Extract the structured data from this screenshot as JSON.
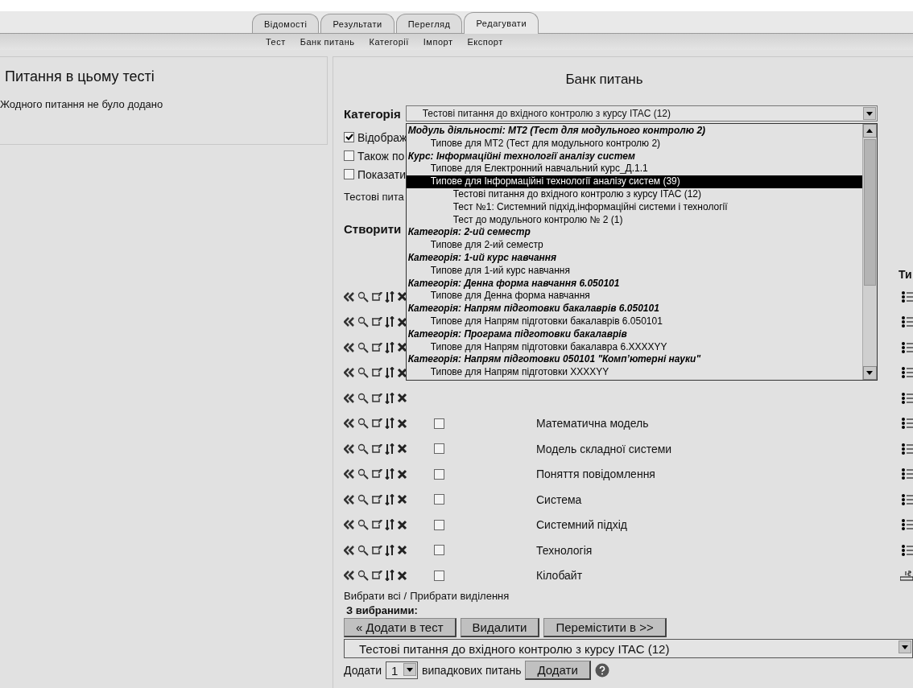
{
  "tabs": [
    {
      "label": "Відомості",
      "selected": false
    },
    {
      "label": "Результати",
      "selected": false
    },
    {
      "label": "Перегляд",
      "selected": false
    },
    {
      "label": "Редагувати",
      "selected": true
    }
  ],
  "subnav": [
    "Тест",
    "Банк питань",
    "Категорії",
    "Імпорт",
    "Експорт"
  ],
  "left_panel": {
    "title": "Питання в цьому тесті",
    "message": "Жодного питання не було додано"
  },
  "bank": {
    "title": "Банк питань",
    "category_label": "Категорія",
    "category_value": "Тестові питання до вхідного контролю з курсу ITAC (12)",
    "category_list": [
      {
        "kind": "group",
        "label": "Модуль діяльності: МТ2 (Тест для модульного контролю 2)",
        "children": [
          {
            "kind": "option",
            "label": "Типове для МТ2 (Тест для модульного контролю 2)",
            "selected": false
          }
        ]
      },
      {
        "kind": "group",
        "label": "Курс: Інформаційні технології аналізу систем",
        "children": [
          {
            "kind": "option",
            "label": "Типове для Електронний навчальний курс_Д.1.1",
            "selected": false
          },
          {
            "kind": "option",
            "label": "Типове для Інформаційні технології аналізу систем (39)",
            "selected": true,
            "children": [
              {
                "kind": "option",
                "label": "Тестові питання до вхідного контролю з курсу ITAC (12)",
                "selected": false
              },
              {
                "kind": "option",
                "label": "Тест №1: Системний підхід,інформаційні системи і технології",
                "selected": false
              },
              {
                "kind": "option",
                "label": "Тест до модульного контролю № 2 (1)",
                "selected": false
              }
            ]
          }
        ]
      },
      {
        "kind": "group",
        "label": "Категорія: 2-ий семестр",
        "children": [
          {
            "kind": "option",
            "label": "Типове для 2-ий семестр",
            "selected": false
          }
        ]
      },
      {
        "kind": "group",
        "label": "Категорія: 1-ий курс навчання",
        "children": [
          {
            "kind": "option",
            "label": "Типове для 1-ий курс навчання",
            "selected": false
          }
        ]
      },
      {
        "kind": "group",
        "label": "Категорія: Денна форма навчання 6.050101",
        "children": [
          {
            "kind": "option",
            "label": "Типове для Денна форма навчання",
            "selected": false
          }
        ]
      },
      {
        "kind": "group",
        "label": "Категорія: Напрям підготовки бакалаврів 6.050101",
        "children": [
          {
            "kind": "option",
            "label": "Типове для Напрям підготовки бакалаврів 6.050101",
            "selected": false
          }
        ]
      },
      {
        "kind": "group",
        "label": "Категорія: Програма підготовки бакалаврів",
        "children": [
          {
            "kind": "option",
            "label": "Типове для Напрям підготовки бакалавра 6.XXXXYY",
            "selected": false
          }
        ]
      },
      {
        "kind": "group",
        "label": "Категорія: Напрям підготовки 050101 \"Комп’ютерні науки\"",
        "children": [
          {
            "kind": "option",
            "label": "Типове для Напрям підготовки XXXXYY",
            "selected": false
          }
        ]
      }
    ],
    "options": [
      {
        "label": "Відображ",
        "checked": true
      },
      {
        "label": "Також по",
        "checked": false
      },
      {
        "label": "Показати",
        "checked": false
      }
    ],
    "category_info": "Тестові пита",
    "create_label": "Створити",
    "type_header": "Ти",
    "questions": [
      {
        "kind": "multichoice"
      },
      {
        "kind": "multichoice"
      },
      {
        "kind": "multichoice"
      },
      {
        "kind": "multichoice"
      },
      {
        "kind": "multichoice"
      },
      {
        "name": "Математична модель",
        "kind": "multichoice",
        "checked": false
      },
      {
        "name": "Модель складної системи",
        "kind": "multichoice",
        "checked": false
      },
      {
        "name": "Поняття повідомлення",
        "kind": "multichoice",
        "checked": false
      },
      {
        "name": "Система",
        "kind": "multichoice",
        "checked": false
      },
      {
        "name": "Системний підхід",
        "kind": "multichoice",
        "checked": false
      },
      {
        "name": "Технологія",
        "kind": "multichoice",
        "checked": false
      },
      {
        "name": "Кілобайт",
        "kind": "numerical",
        "checked": false
      }
    ],
    "select_all": "Вибрати всі",
    "select_separator": "/",
    "deselect": "Прибрати виділення",
    "with_selected": "З вибраними:",
    "actions": [
      "« Додати в тест",
      "Видалити",
      "Перемістити в >>"
    ],
    "move_target": "Тестові питання до вхідного контролю з курсу ITAC (12)",
    "random": {
      "prefix": "Додати",
      "count": "1",
      "suffix": "випадкових питань",
      "button": "Додати"
    }
  }
}
